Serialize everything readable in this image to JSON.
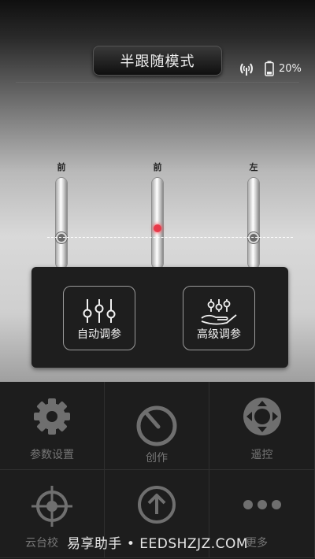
{
  "header": {
    "mode_label": "半跟随模式",
    "battery_text": "20%"
  },
  "sliders": [
    {
      "label": "前"
    },
    {
      "label": "前"
    },
    {
      "label": "左"
    }
  ],
  "tune_panel": {
    "auto_tune_label": "自动调参",
    "advanced_tune_label": "高级调参"
  },
  "grid": {
    "items": [
      {
        "label": "参数设置",
        "icon": "gear-icon"
      },
      {
        "label": "创作",
        "icon": "timer-icon"
      },
      {
        "label": "遥控",
        "icon": "dpad-icon"
      },
      {
        "label": "云台校",
        "icon": "crosshair-icon"
      },
      {
        "label": "",
        "icon": "upload-icon"
      },
      {
        "label": "更多",
        "icon": "more-icon"
      }
    ]
  },
  "watermark": "易享助手 • EEDSHZJZ.COM"
}
